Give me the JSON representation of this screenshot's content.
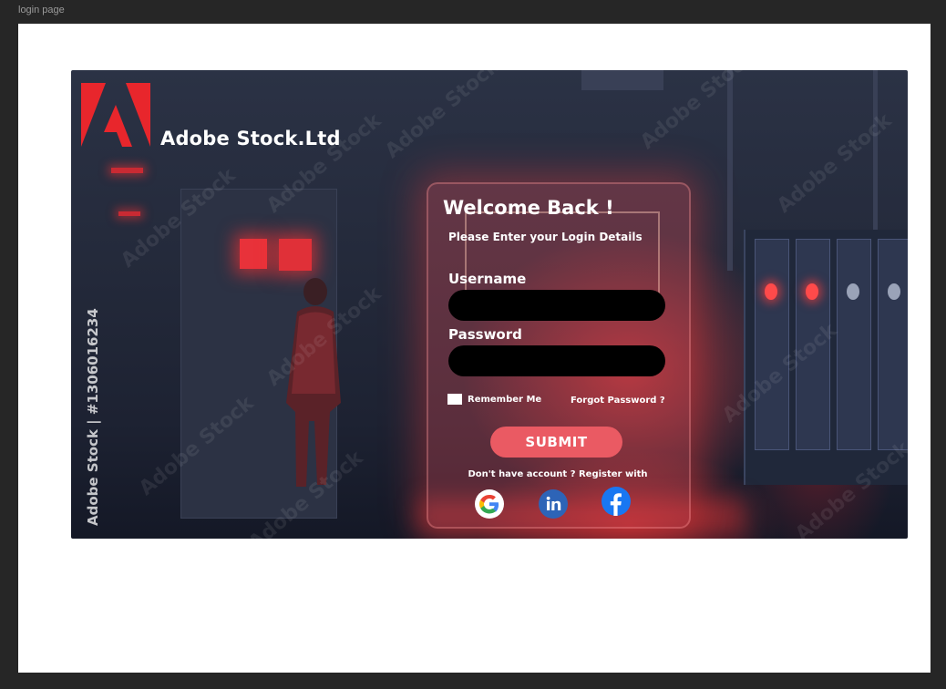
{
  "frame_label": "login page",
  "brand": {
    "name": "Adobe Stock.Ltd",
    "logo_icon": "adobe-logo-icon",
    "side_caption": "Adobe Stock | #1306016234",
    "watermark": "Adobe Stock"
  },
  "login": {
    "title": "Welcome Back !",
    "subtitle": "Please Enter your Login Details",
    "username_label": "Username",
    "username_value": "",
    "password_label": "Password",
    "password_value": "",
    "remember_label": "Remember Me",
    "remember_checked": false,
    "forgot_label": "Forgot Password ?",
    "submit_label": "SUBMIT",
    "register_text": "Don't have account ? Register with"
  },
  "social": [
    {
      "name": "google",
      "icon": "google-icon"
    },
    {
      "name": "linkedin",
      "icon": "linkedin-icon"
    },
    {
      "name": "facebook",
      "icon": "facebook-icon"
    }
  ],
  "colors": {
    "accent": "#ea5a63",
    "logo_red": "#e8262c",
    "input_bg": "#000000",
    "linkedin": "#0a66c2",
    "facebook": "#1877f2"
  }
}
